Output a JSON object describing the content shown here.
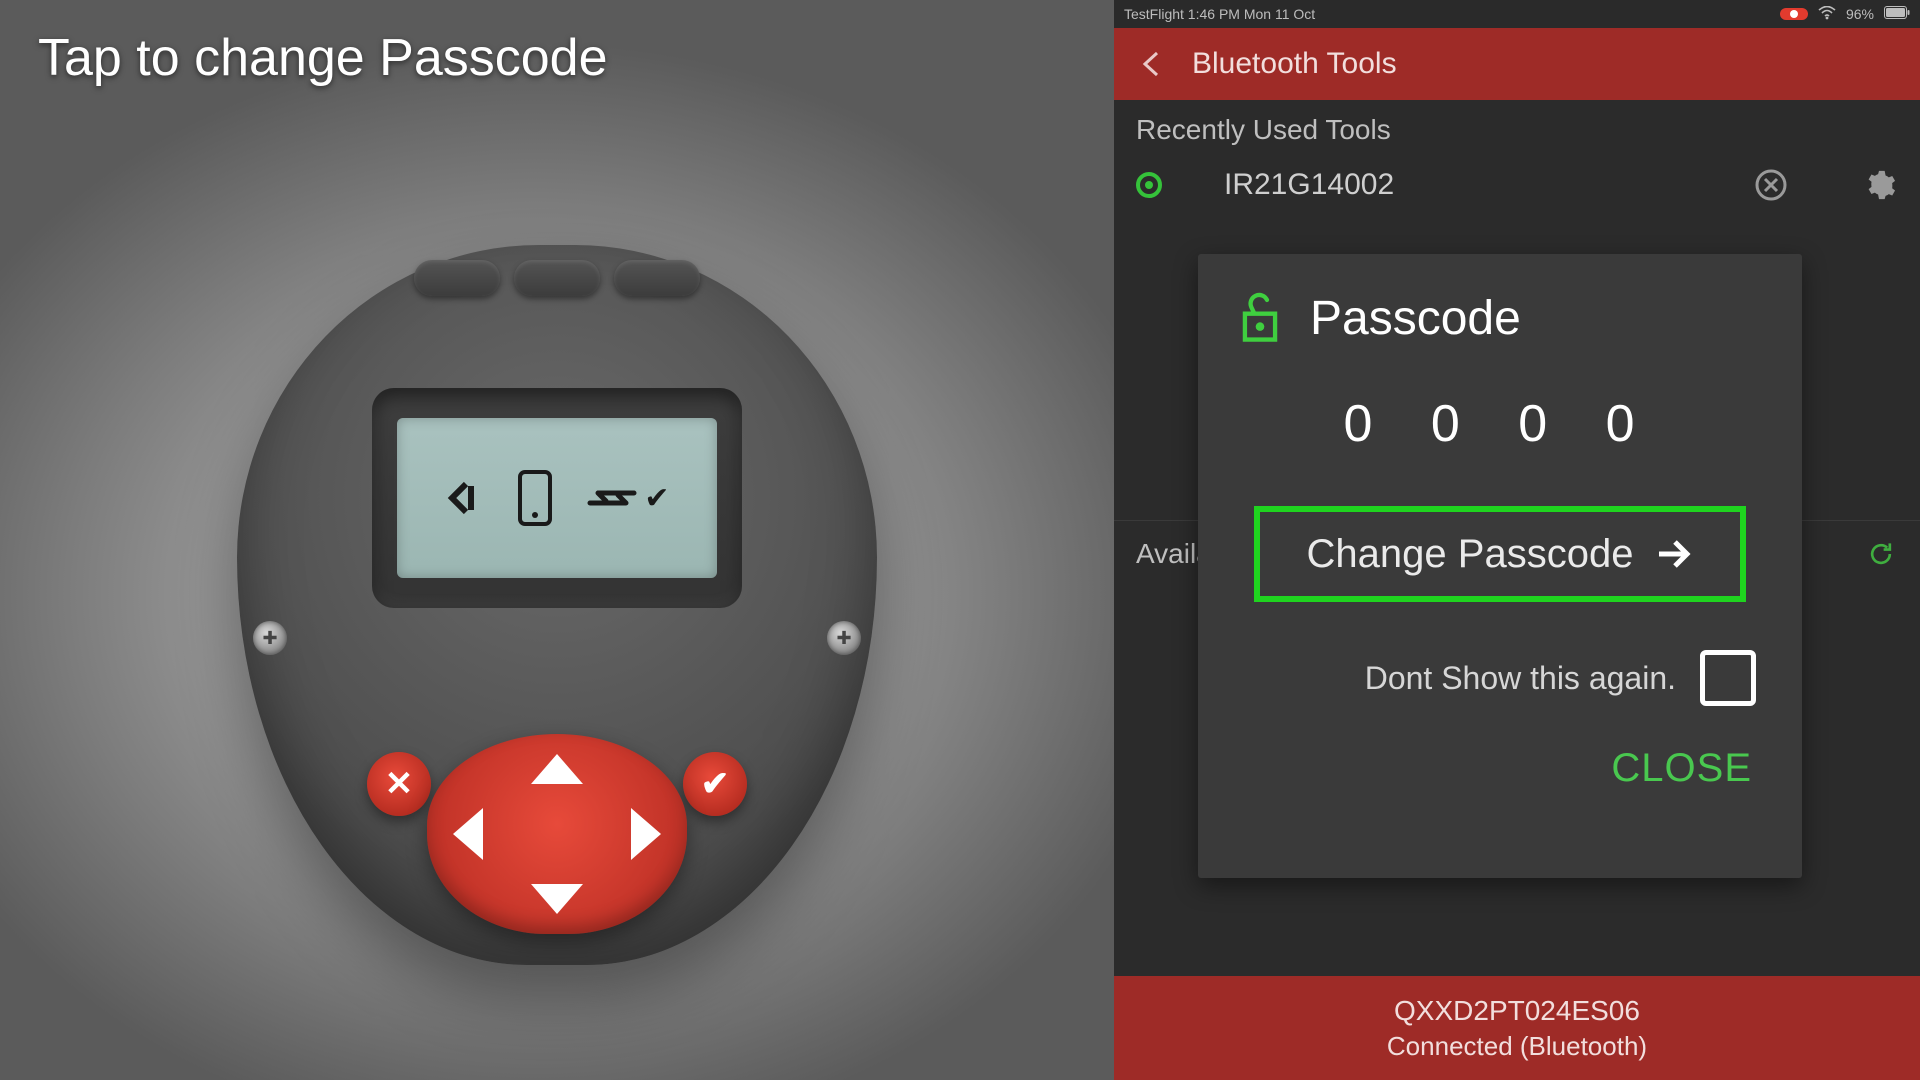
{
  "instruction": "Tap to change Passcode",
  "status_bar": {
    "left_text": "TestFlight  1:46 PM   Mon 11 Oct",
    "battery_text": "96%"
  },
  "nav": {
    "title": "Bluetooth Tools"
  },
  "sections": {
    "recent_header": "Recently Used Tools",
    "available_header": "Available Tools"
  },
  "tool": {
    "name": "IR21G14002"
  },
  "modal": {
    "title": "Passcode",
    "code": "0 0 0 0",
    "change_label": "Change Passcode",
    "dont_show_label": "Dont Show this again.",
    "close_label": "CLOSE"
  },
  "footer": {
    "serial": "QXXD2PT024ES06",
    "status": "Connected (Bluetooth)"
  }
}
